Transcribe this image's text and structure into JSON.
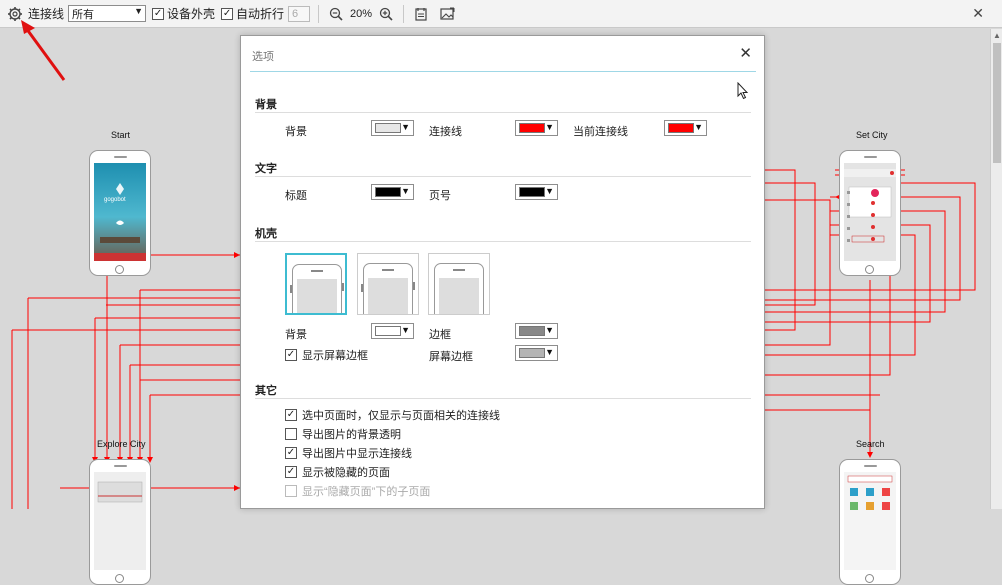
{
  "toolbar": {
    "link_label": "连接线",
    "filter_value": "所有",
    "device_frame_label": "设备外壳",
    "device_frame_checked": true,
    "auto_wrap_label": "自动折行",
    "auto_wrap_checked": true,
    "wrap_count": "6",
    "zoom_level": "20%"
  },
  "pages": [
    {
      "title": "Start"
    },
    {
      "title": "Set City"
    },
    {
      "title": "Explore City"
    },
    {
      "title": "Search"
    }
  ],
  "start_screen": {
    "brand": "gogobot"
  },
  "dialog": {
    "title": "选项",
    "background_section": {
      "heading": "背景",
      "background_label": "背景",
      "background_color": "#e6e6e6",
      "link_label": "连接线",
      "link_color": "#ff0000",
      "current_link_label": "当前连接线",
      "current_link_color": "#ff0000"
    },
    "text_section": {
      "heading": "文字",
      "title_label": "标题",
      "title_color": "#000000",
      "page_number_label": "页号",
      "page_number_color": "#000000"
    },
    "shell_section": {
      "heading": "机壳",
      "background_label": "背景",
      "background_color": "#ffffff",
      "border_label": "边框",
      "border_color": "#888888",
      "show_screen_border_label": "显示屏幕边框",
      "show_screen_border_checked": true,
      "screen_border_label": "屏幕边框",
      "screen_border_color": "#b4b4b4"
    },
    "other_section": {
      "heading": "其它",
      "options": [
        {
          "label": "选中页面时，仅显示与页面相关的连接线",
          "checked": true,
          "disabled": false
        },
        {
          "label": "导出图片的背景透明",
          "checked": false,
          "disabled": false
        },
        {
          "label": "导出图片中显示连接线",
          "checked": true,
          "disabled": false
        },
        {
          "label": "显示被隐藏的页面",
          "checked": true,
          "disabled": false
        },
        {
          "label": "显示“隐藏页面”下的子页面",
          "checked": false,
          "disabled": true
        }
      ]
    }
  },
  "colors": {
    "accent": "#3dbcd1",
    "link_line": "#ff0000",
    "annotation_arrow": "#e01010"
  }
}
